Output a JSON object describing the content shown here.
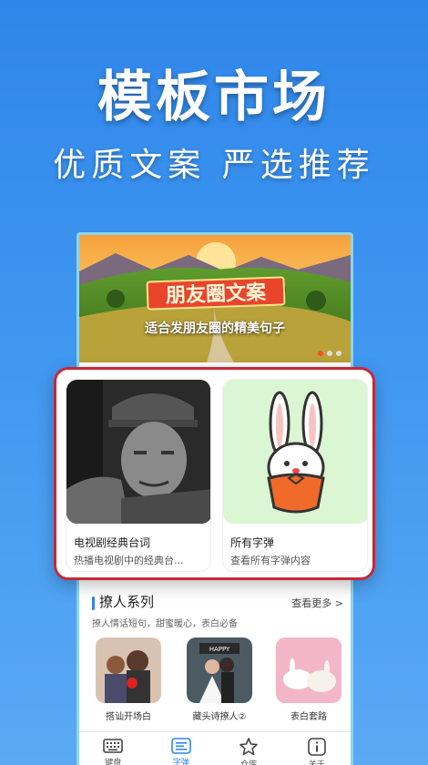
{
  "headline": "模板市场",
  "subline": "优质文案  严选推荐",
  "banner": {
    "title": "朋友圈文案",
    "subtitle": "适合发朋友圈的精美句子",
    "page_count": 3,
    "active_index": 0
  },
  "popup": {
    "cards": [
      {
        "title": "电视剧经典台词",
        "desc": "热播电视剧中的经典台..."
      },
      {
        "title": "所有字弹",
        "desc": "查看所有字弹内容"
      }
    ]
  },
  "section": {
    "title": "撩人系列",
    "more": "查看更多 >",
    "desc": "撩人情话短句，甜蜜暖心，表白必备",
    "items": [
      {
        "label": "搭讪开场白"
      },
      {
        "label": "藏头诗撩人②"
      },
      {
        "label": "表白套路"
      }
    ],
    "happy_text": "HAPPY"
  },
  "tabbar": {
    "tabs": [
      {
        "label": "键盘",
        "icon": "keyboard-icon"
      },
      {
        "label": "字弹",
        "icon": "text-bullet-icon"
      },
      {
        "label": "仓库",
        "icon": "star-icon"
      },
      {
        "label": "关于",
        "icon": "info-icon"
      }
    ],
    "active_index": 1
  },
  "colors": {
    "background": "#3f97f0",
    "accent": "#2f86ea",
    "popup_border": "#c8273a",
    "phone_border": "#8ad6ee"
  }
}
